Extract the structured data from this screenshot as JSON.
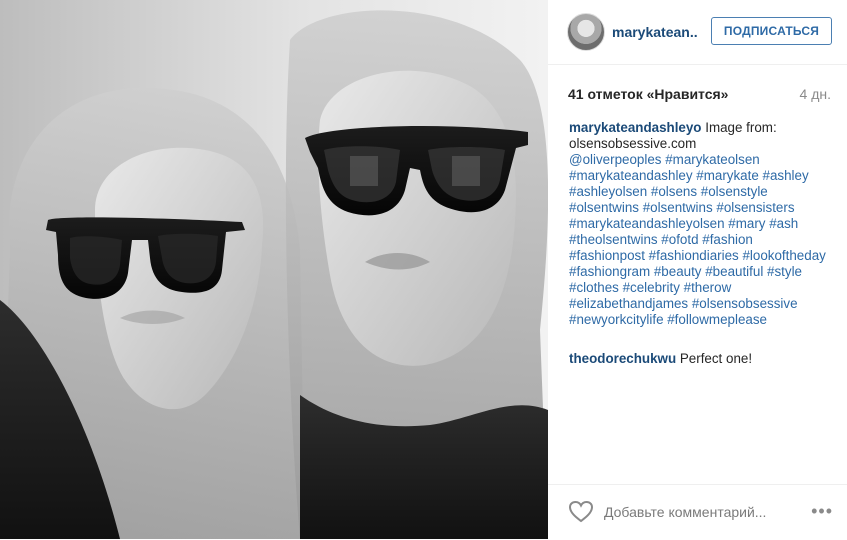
{
  "post": {
    "username_short": "marykatean..",
    "follow_label": "ПОДПИСАТЬСЯ",
    "likes": "41 отметок «Нравится»",
    "age": "4 дн."
  },
  "caption": {
    "username": "marykateandashleyo",
    "text": " Image from: olsensobsessive.com",
    "tags": " @oliverpeoples #marykateolsen #marykateandashley #marykate #ashley #ashleyolsen #olsens #olsenstyle #olsentwins #olsentwins #olsensisters #marykateandashleyolsen #mary #ash #theolsentwins #ofotd #fashion #fashionpost #fashiondiaries #lookoftheday #fashiongram #beauty #beautiful #style #clothes #celebrity #therow #elizabethandjames #olsensobsessive #newyorkcitylife #followmeplease"
  },
  "comment": {
    "username": "theodorechukwu",
    "text": " Perfect one!"
  },
  "footer": {
    "add_comment_placeholder": "Добавьте комментарий...",
    "more_glyph": "•••",
    "heart_icon": "heart-outline-icon"
  }
}
